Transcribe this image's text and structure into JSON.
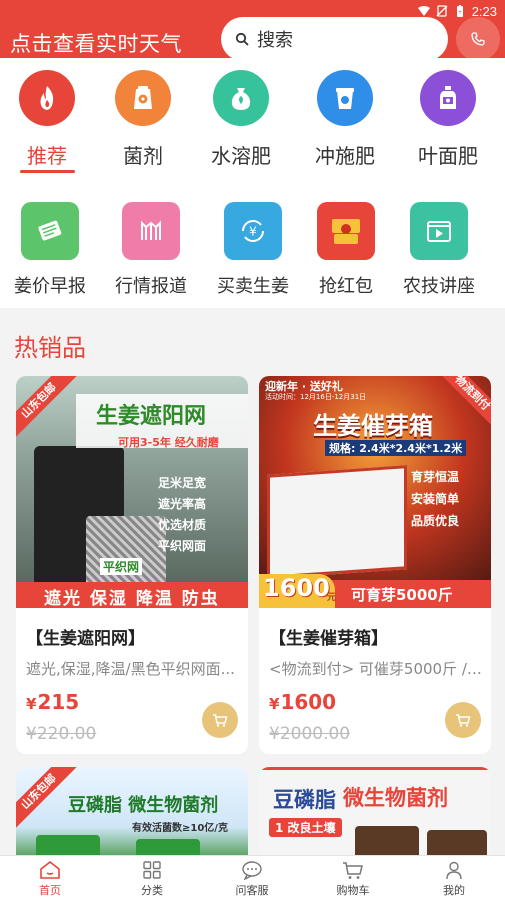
{
  "status_bar": {
    "time": "2:23"
  },
  "header": {
    "weather_link": "点击查看实时天气",
    "search_placeholder": "搜索",
    "phone_icon": "phone-icon"
  },
  "categories": [
    {
      "label": "推荐",
      "icon": "flame-icon",
      "color": "#e8453a",
      "active": true
    },
    {
      "label": "菌剂",
      "icon": "fertilizer-bag-icon",
      "color": "#f1843a"
    },
    {
      "label": "水溶肥",
      "icon": "sack-icon",
      "color": "#36c29a"
    },
    {
      "label": "冲施肥",
      "icon": "bucket-icon",
      "color": "#2f8ee8"
    },
    {
      "label": "叶面肥",
      "icon": "bottle-icon",
      "color": "#8c4fd8"
    }
  ],
  "services": [
    {
      "label": "姜价早报",
      "icon": "newspaper-icon",
      "color": "#5cc46a"
    },
    {
      "label": "行情报道",
      "icon": "chart-icon",
      "color": "#f07da9"
    },
    {
      "label": "买卖生姜",
      "icon": "exchange-yen-icon",
      "color": "#38a8e0"
    },
    {
      "label": "抢红包",
      "icon": "red-envelope-icon",
      "color": "#e8453a"
    },
    {
      "label": "农技讲座",
      "icon": "video-icon",
      "color": "#3cc2a0"
    }
  ],
  "hot": {
    "title": "热销品",
    "products": [
      {
        "title": "【生姜遮阳网】",
        "desc": "遮光,保湿,降温/黑色平织网面...",
        "price": "215",
        "original_price": "¥220.00",
        "image": {
          "ribbon": "山东包邮",
          "headline": "生姜遮阳网",
          "subline": "可用3-5年  经久耐磨",
          "features": [
            "足米足宽",
            "遮光率高",
            "优选材质",
            "平织网面"
          ],
          "tag": "平织网",
          "footer": "遮光 保湿 降温 防虫"
        }
      },
      {
        "title": "【生姜催芽箱】",
        "desc": "<物流到付> 可催芽5000斤 / ...",
        "price": "1600",
        "original_price": "¥2000.00",
        "image": {
          "top_left": "迎新年 · 送好礼",
          "top_left_sub": "活动时间：12月16日-12月31日",
          "ribbon": "物流到付",
          "headline": "生姜催芽箱",
          "spec": "规格: 2.4米*2.4米*1.2米",
          "features": [
            "育芽恒温",
            "安装简单",
            "品质优良"
          ],
          "price_tag": "1600",
          "price_unit": "元",
          "footer": "可育芽5000斤"
        }
      },
      {
        "image": {
          "ribbon": "山东包邮",
          "headline": "豆磷脂 微生物菌剂",
          "subline": "有效活菌数≥10亿/克"
        }
      },
      {
        "image": {
          "headline_a": "豆磷脂",
          "headline_b": "微生物菌剂",
          "badge": "1 改良土壤"
        }
      }
    ]
  },
  "tabbar": [
    {
      "label": "首页",
      "icon": "home-icon",
      "active": true
    },
    {
      "label": "分类",
      "icon": "grid-icon"
    },
    {
      "label": "问客服",
      "icon": "chat-icon"
    },
    {
      "label": "购物车",
      "icon": "cart-icon"
    },
    {
      "label": "我的",
      "icon": "user-icon"
    }
  ],
  "colors": {
    "brand": "#e8453a",
    "cart_button": "#e8c47a"
  }
}
